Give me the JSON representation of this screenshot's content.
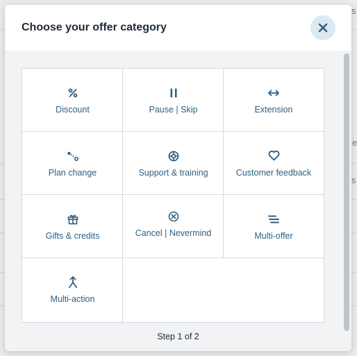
{
  "background": {
    "fragment_1": "s",
    "fragment_2": "e",
    "fragment_3": "s"
  },
  "modal": {
    "title": "Choose your offer category",
    "close_icon": "close-icon",
    "step_text": "Step 1 of 2",
    "colors": {
      "accent": "#2e5f82",
      "close_bg": "#dbe9f3",
      "title": "#1f2a36"
    }
  },
  "categories": [
    {
      "label": "Discount",
      "icon": "percent-icon"
    },
    {
      "label": "Pause | Skip",
      "icon": "pause-icon"
    },
    {
      "label": "Extension",
      "icon": "arrows-horizontal-icon"
    },
    {
      "label": "Plan change",
      "icon": "plan-change-icon"
    },
    {
      "label": "Support & training",
      "icon": "lifebuoy-icon"
    },
    {
      "label": "Customer feedback",
      "icon": "heart-icon"
    },
    {
      "label": "Gifts & credits",
      "icon": "gift-icon"
    },
    {
      "label": "Cancel | Nevermind",
      "icon": "cancel-circle-icon"
    },
    {
      "label": "Multi-offer",
      "icon": "lines-icon"
    },
    {
      "label": "Multi-action",
      "icon": "merge-arrows-icon"
    }
  ]
}
